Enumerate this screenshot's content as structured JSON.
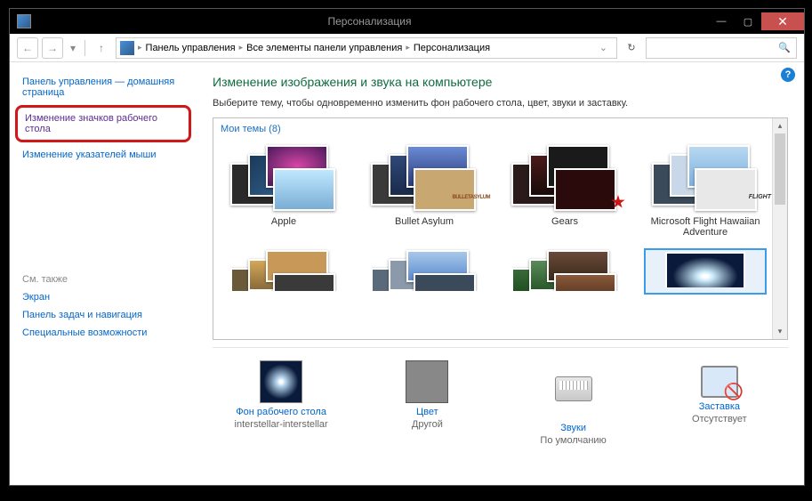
{
  "window": {
    "title": "Персонализация"
  },
  "breadcrumb": {
    "items": [
      "Панель управления",
      "Все элементы панели управления",
      "Персонализация"
    ]
  },
  "sidebar": {
    "home": "Панель управления — домашняя страница",
    "highlighted": "Изменение значков рабочего стола",
    "link2": "Изменение указателей мыши",
    "seealso": "См. также",
    "sa1": "Экран",
    "sa2": "Панель задач и навигация",
    "sa3": "Специальные возможности"
  },
  "main": {
    "heading": "Изменение изображения и звука на компьютере",
    "subtitle": "Выберите тему, чтобы одновременно изменить фон рабочего стола, цвет, звуки и заставку.",
    "themes_header": "Мои темы (8)",
    "themes": [
      "Apple",
      "Bullet Asylum",
      "Gears",
      "Microsoft Flight Hawaiian Adventure"
    ],
    "bottom": {
      "bg": {
        "title": "Фон рабочего стола",
        "sub": "interstellar-interstellar"
      },
      "color": {
        "title": "Цвет",
        "sub": "Другой"
      },
      "sound": {
        "title": "Звуки",
        "sub": "По умолчанию"
      },
      "saver": {
        "title": "Заставка",
        "sub": "Отсутствует"
      }
    }
  }
}
